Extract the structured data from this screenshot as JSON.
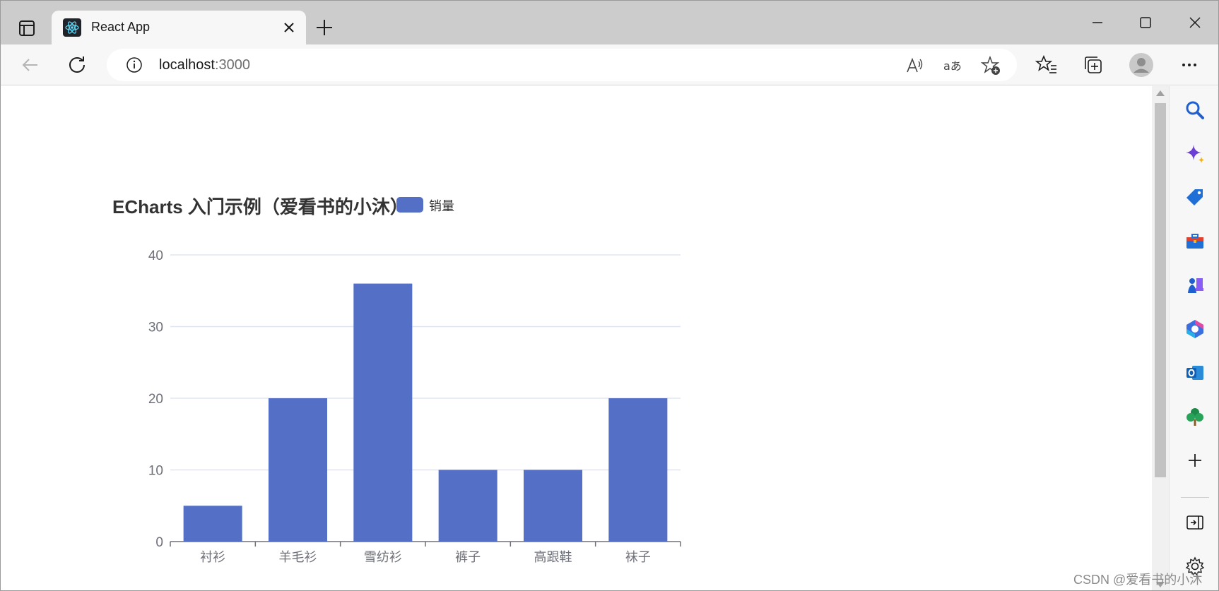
{
  "browser": {
    "tab_title": "React App",
    "url_host": "localhost",
    "url_port": ":3000"
  },
  "colors": {
    "bar": "#5470c6",
    "axis_text": "#6e7079",
    "grid": "#e0e6f1",
    "title": "#333333"
  },
  "chart_data": {
    "type": "bar",
    "title": "ECharts 入门示例（爱看书的小沐）",
    "legend": [
      "销量"
    ],
    "categories": [
      "衬衫",
      "羊毛衫",
      "雪纺衫",
      "裤子",
      "高跟鞋",
      "袜子"
    ],
    "series": [
      {
        "name": "销量",
        "values": [
          5,
          20,
          36,
          10,
          10,
          20
        ]
      }
    ],
    "ylim": [
      0,
      40
    ],
    "yticks": [
      "0",
      "10",
      "20",
      "30",
      "40"
    ],
    "grid": true,
    "legend_position": "top"
  },
  "watermark": "CSDN @爱看书的小沐"
}
